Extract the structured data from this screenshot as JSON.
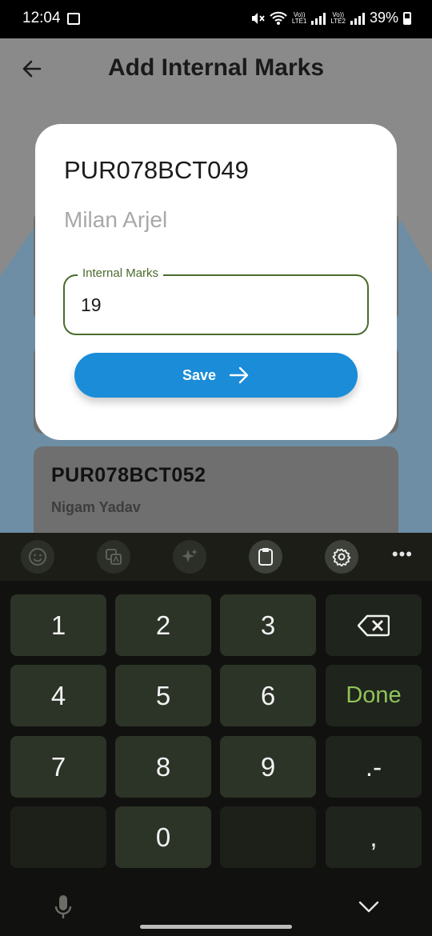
{
  "status_bar": {
    "time": "12:04",
    "battery": "39%",
    "icons": [
      "image-icon",
      "mute-icon",
      "wifi-icon",
      "signal-icon",
      "battery-icon"
    ],
    "sim1": "Vo)) LTE1",
    "sim2": "Vo)) LTE2"
  },
  "app_bar": {
    "title": "Add Internal Marks",
    "back_icon": "arrow-left-icon"
  },
  "background_list": [
    {
      "roll": "PUR078BCT052",
      "name": "Nigam Yadav"
    }
  ],
  "dialog": {
    "roll": "PUR078BCT049",
    "name": "Milan Arjel",
    "field_label": "Internal Marks",
    "field_value": "19",
    "save_label": "Save",
    "save_icon": "arrow-right-icon"
  },
  "keyboard": {
    "toolbar": [
      "emoji-icon",
      "translate-icon",
      "sparkle-icon",
      "clipboard-icon",
      "settings-icon",
      "more-icon"
    ],
    "keys": {
      "k1": "1",
      "k2": "2",
      "k3": "3",
      "k4": "4",
      "k5": "5",
      "k6": "6",
      "k7": "7",
      "k8": "8",
      "k9": "9",
      "k0": "0",
      "done": "Done",
      "dotdash": ".-",
      "comma": ","
    },
    "colors": {
      "done": "#8fc45a",
      "accent": "#1a8cd8"
    }
  }
}
